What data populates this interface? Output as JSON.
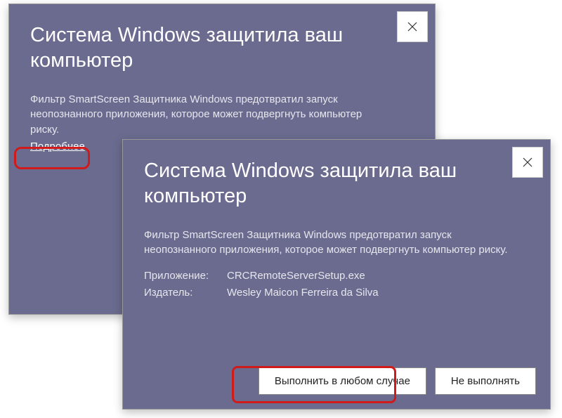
{
  "dialog1": {
    "title": "Система Windows защитила ваш компьютер",
    "description": "Фильтр SmartScreen Защитника Windows предотвратил запуск неопознанного приложения, которое может подвергнуть компьютер риску.",
    "more": "Подробнее"
  },
  "dialog2": {
    "title": "Система Windows защитила ваш компьютер",
    "description": "Фильтр SmartScreen Защитника Windows предотвратил запуск неопознанного приложения, которое может подвергнуть компьютер риску.",
    "app_label": "Приложение:",
    "app_value": "CRCRemoteServerSetup.exe",
    "publisher_label": "Издатель:",
    "publisher_value": "Wesley Maicon Ferreira da Silva",
    "run_anyway": "Выполнить в любом случае",
    "dont_run": "Не выполнять"
  },
  "colors": {
    "bg": "#6b6b8f",
    "highlight": "#d11a1a"
  }
}
